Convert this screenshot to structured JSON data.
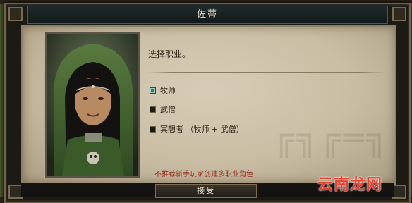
{
  "dialog": {
    "title": "佐蒂",
    "prompt": "选择职业。",
    "options": [
      {
        "label": "牧师",
        "selected": true
      },
      {
        "label": "武僧",
        "selected": false
      },
      {
        "label": "冥想者 （牧师 + 武僧）",
        "selected": false
      }
    ],
    "warning": "不推荐新手玩家创建多职业角色！",
    "accept_label": "接受"
  },
  "watermark": {
    "brand": "云南龙网"
  },
  "colors": {
    "title_bar": "#16201f",
    "parchment": "#cfc5ac",
    "selected_checkbox": "#3f6d6a",
    "warning_text": "#9a2a1a",
    "brand_watermark": "#e34030"
  }
}
